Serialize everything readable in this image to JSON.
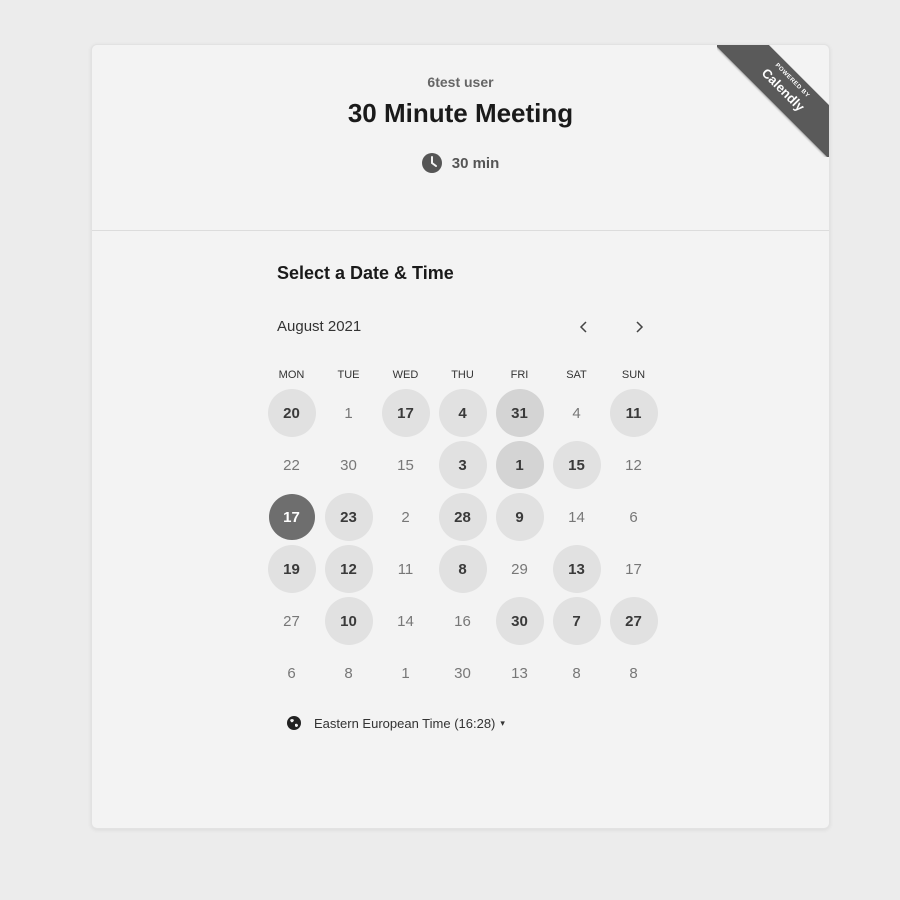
{
  "header": {
    "owner": "6test user",
    "title": "30 Minute Meeting",
    "duration": "30 min",
    "duration_icon": "clock-icon"
  },
  "ribbon": {
    "top": "POWERED BY",
    "bottom": "Calendly"
  },
  "calendar": {
    "section_title": "Select a Date & Time",
    "month": "August 2021",
    "prev_icon": "chevron-left-icon",
    "next_icon": "chevron-right-icon",
    "weekdays": [
      "MON",
      "TUE",
      "WED",
      "THU",
      "FRI",
      "SAT",
      "SUN"
    ],
    "weeks": [
      [
        {
          "d": "20",
          "s": "avail"
        },
        {
          "d": "1",
          "s": "off"
        },
        {
          "d": "17",
          "s": "avail"
        },
        {
          "d": "4",
          "s": "avail"
        },
        {
          "d": "31",
          "s": "avail-dark"
        },
        {
          "d": "4",
          "s": "off"
        },
        {
          "d": "11",
          "s": "avail"
        }
      ],
      [
        {
          "d": "22",
          "s": "off"
        },
        {
          "d": "30",
          "s": "off"
        },
        {
          "d": "15",
          "s": "off"
        },
        {
          "d": "3",
          "s": "avail"
        },
        {
          "d": "1",
          "s": "avail-dark"
        },
        {
          "d": "15",
          "s": "avail"
        },
        {
          "d": "12",
          "s": "off"
        }
      ],
      [
        {
          "d": "17",
          "s": "selected"
        },
        {
          "d": "23",
          "s": "avail"
        },
        {
          "d": "2",
          "s": "off"
        },
        {
          "d": "28",
          "s": "avail"
        },
        {
          "d": "9",
          "s": "avail"
        },
        {
          "d": "14",
          "s": "off"
        },
        {
          "d": "6",
          "s": "off"
        }
      ],
      [
        {
          "d": "19",
          "s": "avail"
        },
        {
          "d": "12",
          "s": "avail"
        },
        {
          "d": "11",
          "s": "off"
        },
        {
          "d": "8",
          "s": "avail"
        },
        {
          "d": "29",
          "s": "off"
        },
        {
          "d": "13",
          "s": "avail"
        },
        {
          "d": "17",
          "s": "off"
        }
      ],
      [
        {
          "d": "27",
          "s": "off"
        },
        {
          "d": "10",
          "s": "avail"
        },
        {
          "d": "14",
          "s": "off"
        },
        {
          "d": "16",
          "s": "off"
        },
        {
          "d": "30",
          "s": "avail"
        },
        {
          "d": "7",
          "s": "avail"
        },
        {
          "d": "27",
          "s": "avail"
        }
      ],
      [
        {
          "d": "6",
          "s": "off"
        },
        {
          "d": "8",
          "s": "off"
        },
        {
          "d": "1",
          "s": "off"
        },
        {
          "d": "30",
          "s": "off"
        },
        {
          "d": "13",
          "s": "off"
        },
        {
          "d": "8",
          "s": "off"
        },
        {
          "d": "8",
          "s": "off"
        }
      ]
    ]
  },
  "timezone": {
    "label": "Eastern European Time (16:28)",
    "icon": "globe-icon",
    "caret": "▾"
  }
}
